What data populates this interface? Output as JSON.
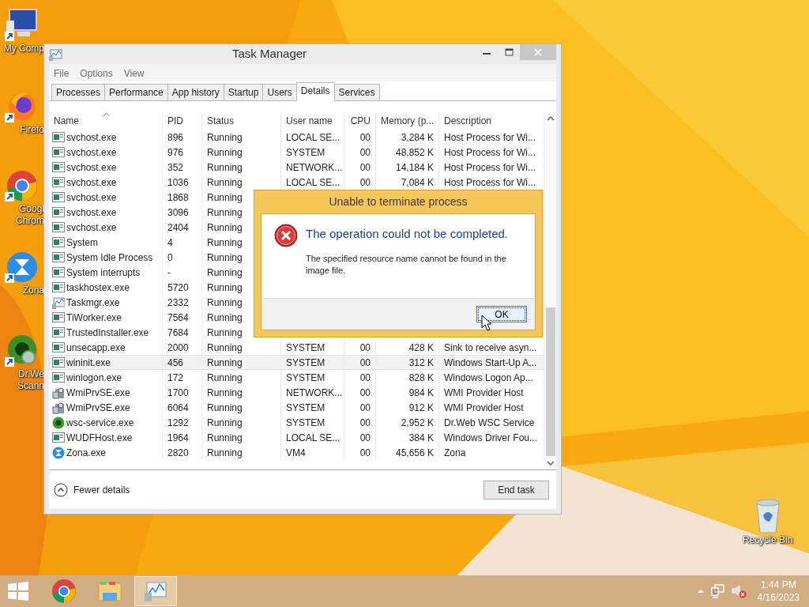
{
  "desktop_icons": [
    {
      "kind": "computer",
      "lines": [
        "My Comp"
      ]
    },
    {
      "kind": "firefox",
      "lines": [
        "Firefo"
      ]
    },
    {
      "kind": "chrome",
      "lines": [
        "Googl",
        "Chrom"
      ]
    },
    {
      "kind": "zona",
      "lines": [
        "Zona"
      ]
    },
    {
      "kind": "drweb",
      "lines": [
        "Dr.We",
        "Scann"
      ]
    }
  ],
  "recycle_bin": {
    "label": "Recycle Bin"
  },
  "window": {
    "title": "Task Manager",
    "menu": [
      "File",
      "Options",
      "View"
    ],
    "tabs": [
      {
        "label": "Processes",
        "selected": false
      },
      {
        "label": "Performance",
        "selected": false
      },
      {
        "label": "App history",
        "selected": false
      },
      {
        "label": "Startup",
        "selected": false
      },
      {
        "label": "Users",
        "selected": false
      },
      {
        "label": "Details",
        "selected": true
      },
      {
        "label": "Services",
        "selected": false
      }
    ],
    "columns": [
      {
        "label": "Name",
        "sorted": true
      },
      {
        "label": "PID",
        "sorted": false
      },
      {
        "label": "Status",
        "sorted": false
      },
      {
        "label": "User name",
        "sorted": false
      },
      {
        "label": "CPU",
        "sorted": false
      },
      {
        "label": "Memory (p...",
        "sorted": false
      },
      {
        "label": "Description",
        "sorted": false
      }
    ],
    "rows": [
      {
        "kind": "service",
        "cells": [
          "svchost.exe",
          "896",
          "Running",
          "LOCAL SE...",
          "00",
          "3,284 K",
          "Host Process for Wi..."
        ],
        "selected": false
      },
      {
        "kind": "service",
        "cells": [
          "svchost.exe",
          "976",
          "Running",
          "SYSTEM",
          "00",
          "48,852 K",
          "Host Process for Wi..."
        ],
        "selected": false
      },
      {
        "kind": "service",
        "cells": [
          "svchost.exe",
          "352",
          "Running",
          "NETWORK...",
          "00",
          "14,184 K",
          "Host Process for Wi..."
        ],
        "selected": false
      },
      {
        "kind": "service",
        "cells": [
          "svchost.exe",
          "1036",
          "Running",
          "LOCAL SE...",
          "00",
          "7,084 K",
          "Host Process for Wi..."
        ],
        "selected": false
      },
      {
        "kind": "service",
        "cells": [
          "svchost.exe",
          "1868",
          "Running"
        ],
        "selected": false
      },
      {
        "kind": "service",
        "cells": [
          "svchost.exe",
          "3096",
          "Running"
        ],
        "selected": false
      },
      {
        "kind": "service",
        "cells": [
          "svchost.exe",
          "2404",
          "Running"
        ],
        "selected": false
      },
      {
        "kind": "service",
        "cells": [
          "System",
          "4",
          "Running"
        ],
        "selected": false
      },
      {
        "kind": "service",
        "cells": [
          "System Idle Process",
          "0",
          "Running"
        ],
        "selected": false
      },
      {
        "kind": "service",
        "cells": [
          "System interrupts",
          "-",
          "Running"
        ],
        "selected": false
      },
      {
        "kind": "service",
        "cells": [
          "taskhostex.exe",
          "5720",
          "Running"
        ],
        "selected": false
      },
      {
        "kind": "taskmgr",
        "cells": [
          "Taskmgr.exe",
          "2332",
          "Running"
        ],
        "selected": false
      },
      {
        "kind": "service",
        "cells": [
          "TiWorker.exe",
          "7564",
          "Running"
        ],
        "selected": false
      },
      {
        "kind": "service",
        "cells": [
          "TrustedInstaller.exe",
          "7684",
          "Running"
        ],
        "selected": false
      },
      {
        "kind": "service",
        "cells": [
          "unsecapp.exe",
          "2000",
          "Running",
          "SYSTEM",
          "00",
          "428 K",
          "Sink to receive asyn..."
        ],
        "selected": false
      },
      {
        "kind": "service",
        "cells": [
          "wininit.exe",
          "456",
          "Running",
          "SYSTEM",
          "00",
          "312 K",
          "Windows Start-Up A..."
        ],
        "selected": true
      },
      {
        "kind": "service",
        "cells": [
          "winlogon.exe",
          "172",
          "Running",
          "SYSTEM",
          "00",
          "828 K",
          "Windows Logon Ap..."
        ],
        "selected": false
      },
      {
        "kind": "wmi",
        "cells": [
          "WmiPrvSE.exe",
          "1700",
          "Running",
          "NETWORK...",
          "00",
          "984 K",
          "WMI Provider Host"
        ],
        "selected": false
      },
      {
        "kind": "wmi",
        "cells": [
          "WmiPrvSE.exe",
          "6064",
          "Running",
          "SYSTEM",
          "00",
          "912 K",
          "WMI Provider Host"
        ],
        "selected": false
      },
      {
        "kind": "drweb",
        "cells": [
          "wsc-service.exe",
          "1292",
          "Running",
          "SYSTEM",
          "00",
          "2,952 K",
          "Dr.Web WSC Service"
        ],
        "selected": false
      },
      {
        "kind": "service",
        "cells": [
          "WUDFHost.exe",
          "1964",
          "Running",
          "LOCAL SE...",
          "00",
          "384 K",
          "Windows Driver Fou..."
        ],
        "selected": false
      },
      {
        "kind": "zona",
        "cells": [
          "Zona.exe",
          "2820",
          "Running",
          "VM4",
          "00",
          "45,656 K",
          "Zona"
        ],
        "selected": false
      }
    ],
    "fewer_details": "Fewer details",
    "end_task": "End task"
  },
  "dialog": {
    "title": "Unable to terminate process",
    "heading": "The operation could not be completed.",
    "message": "The specified resource name cannot be found in the image file.",
    "button": "OK"
  },
  "taskbar": {
    "apps": [
      {
        "kind": "start",
        "selected": false
      },
      {
        "kind": "chrome",
        "selected": false
      },
      {
        "kind": "explorer",
        "selected": false
      },
      {
        "kind": "taskmgr",
        "selected": true
      }
    ],
    "time": "1:44 PM",
    "date": "4/16/2023"
  }
}
